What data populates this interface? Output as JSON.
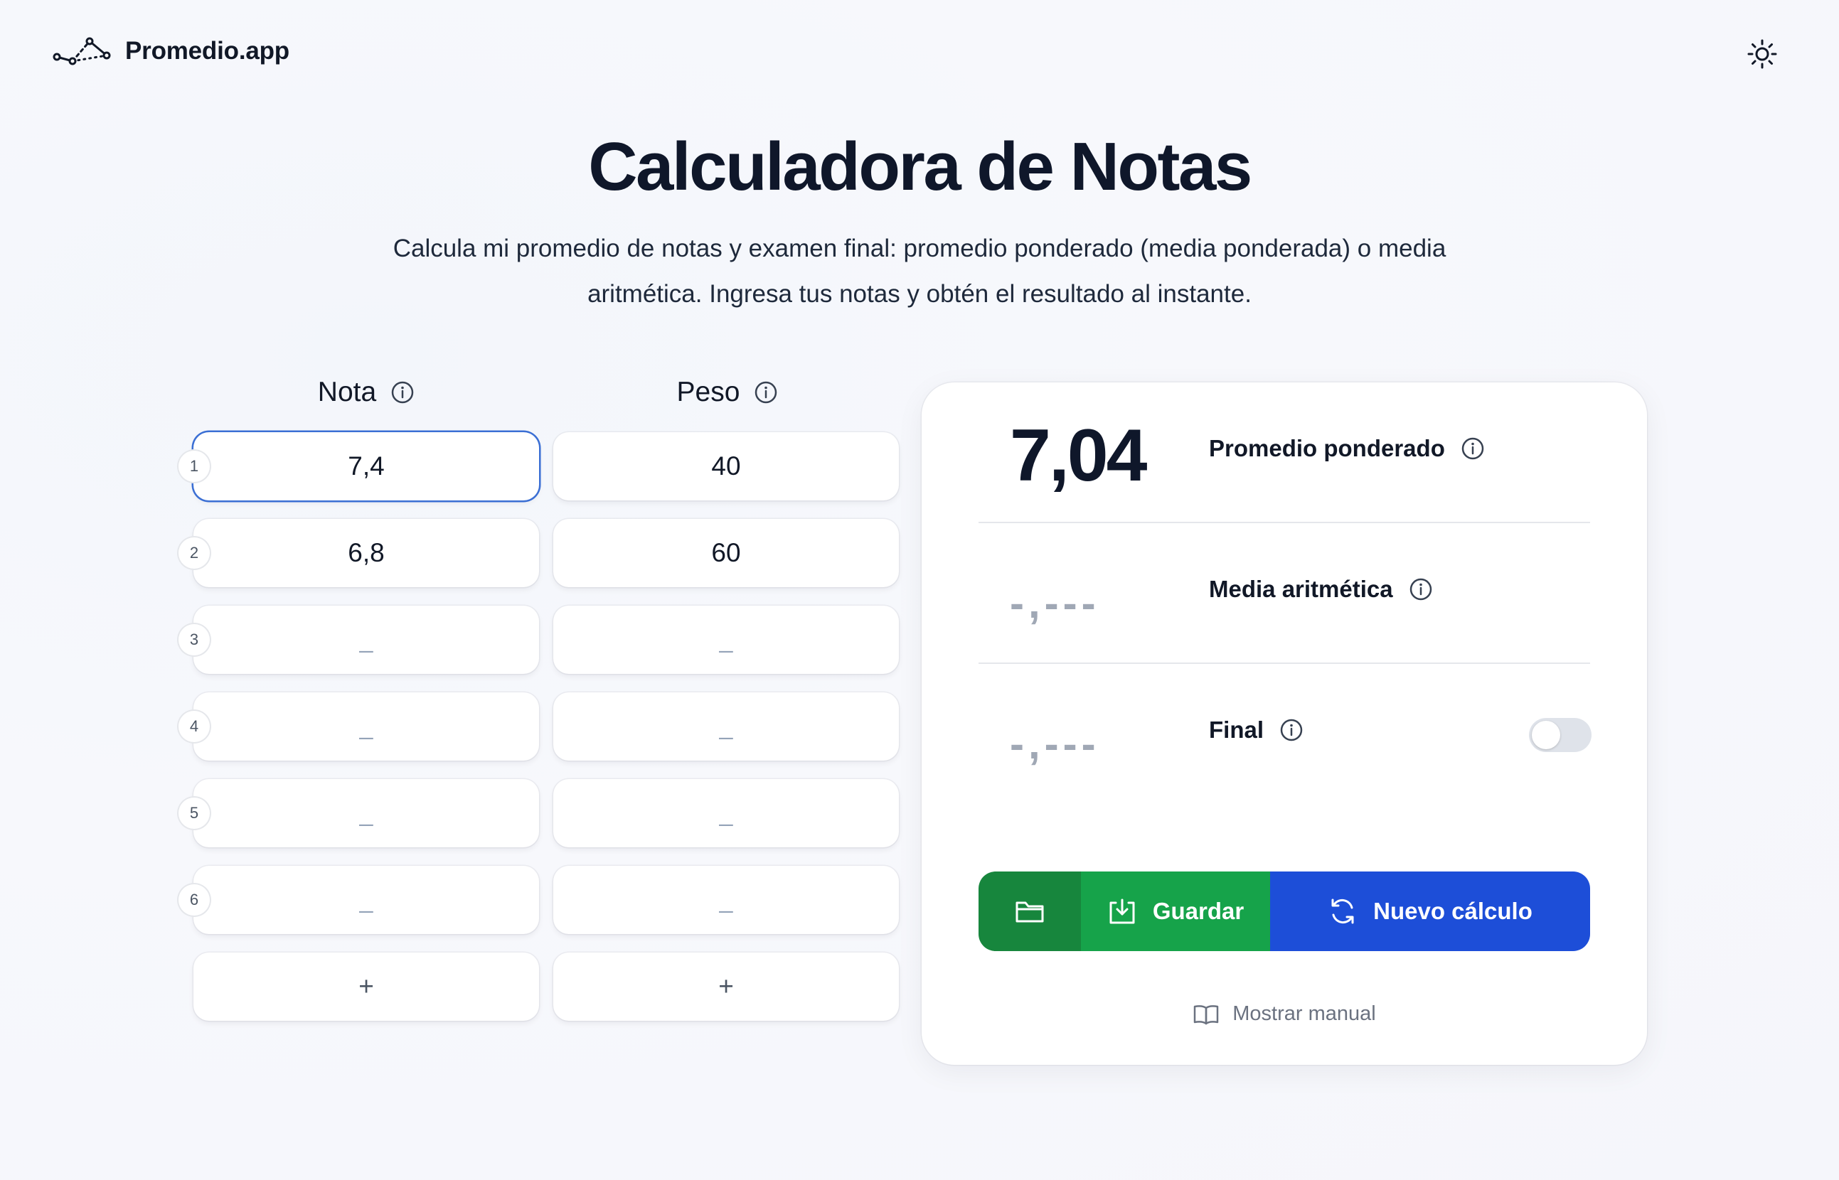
{
  "header": {
    "logo_text": "Promedio.app",
    "logo_icon": "chart-line-icon",
    "theme_icon": "sun-icon"
  },
  "hero": {
    "title": "Calculadora de Notas",
    "subtitle": "Calcula mi promedio de notas y examen final: promedio ponderado (media ponderada) o media aritmética. Ingresa tus notas y obtén el resultado al instante."
  },
  "table": {
    "col_grade": "Nota",
    "col_weight": "Peso",
    "placeholder": "_",
    "add_label": "+",
    "rows": [
      {
        "num": "1",
        "grade": "7,4",
        "weight": "40"
      },
      {
        "num": "2",
        "grade": "6,8",
        "weight": "60"
      },
      {
        "num": "3",
        "grade": "",
        "weight": ""
      },
      {
        "num": "4",
        "grade": "",
        "weight": ""
      },
      {
        "num": "5",
        "grade": "",
        "weight": ""
      },
      {
        "num": "6",
        "grade": "",
        "weight": ""
      }
    ]
  },
  "results": {
    "weighted": {
      "value": "7,04",
      "label": "Promedio ponderado"
    },
    "arithmetic": {
      "value": "-,---",
      "label": "Media aritmética"
    },
    "final": {
      "value": "-,---",
      "label": "Final",
      "toggle_on": false
    }
  },
  "actions": {
    "folder_icon": "folder-icon",
    "save_label": "Guardar",
    "new_label": "Nuevo cálculo",
    "manual_label": "Mostrar manual"
  },
  "colors": {
    "save": "#16a34a",
    "folder": "#17863d",
    "new": "#1d4ed8",
    "focus": "#3b6fd4"
  }
}
